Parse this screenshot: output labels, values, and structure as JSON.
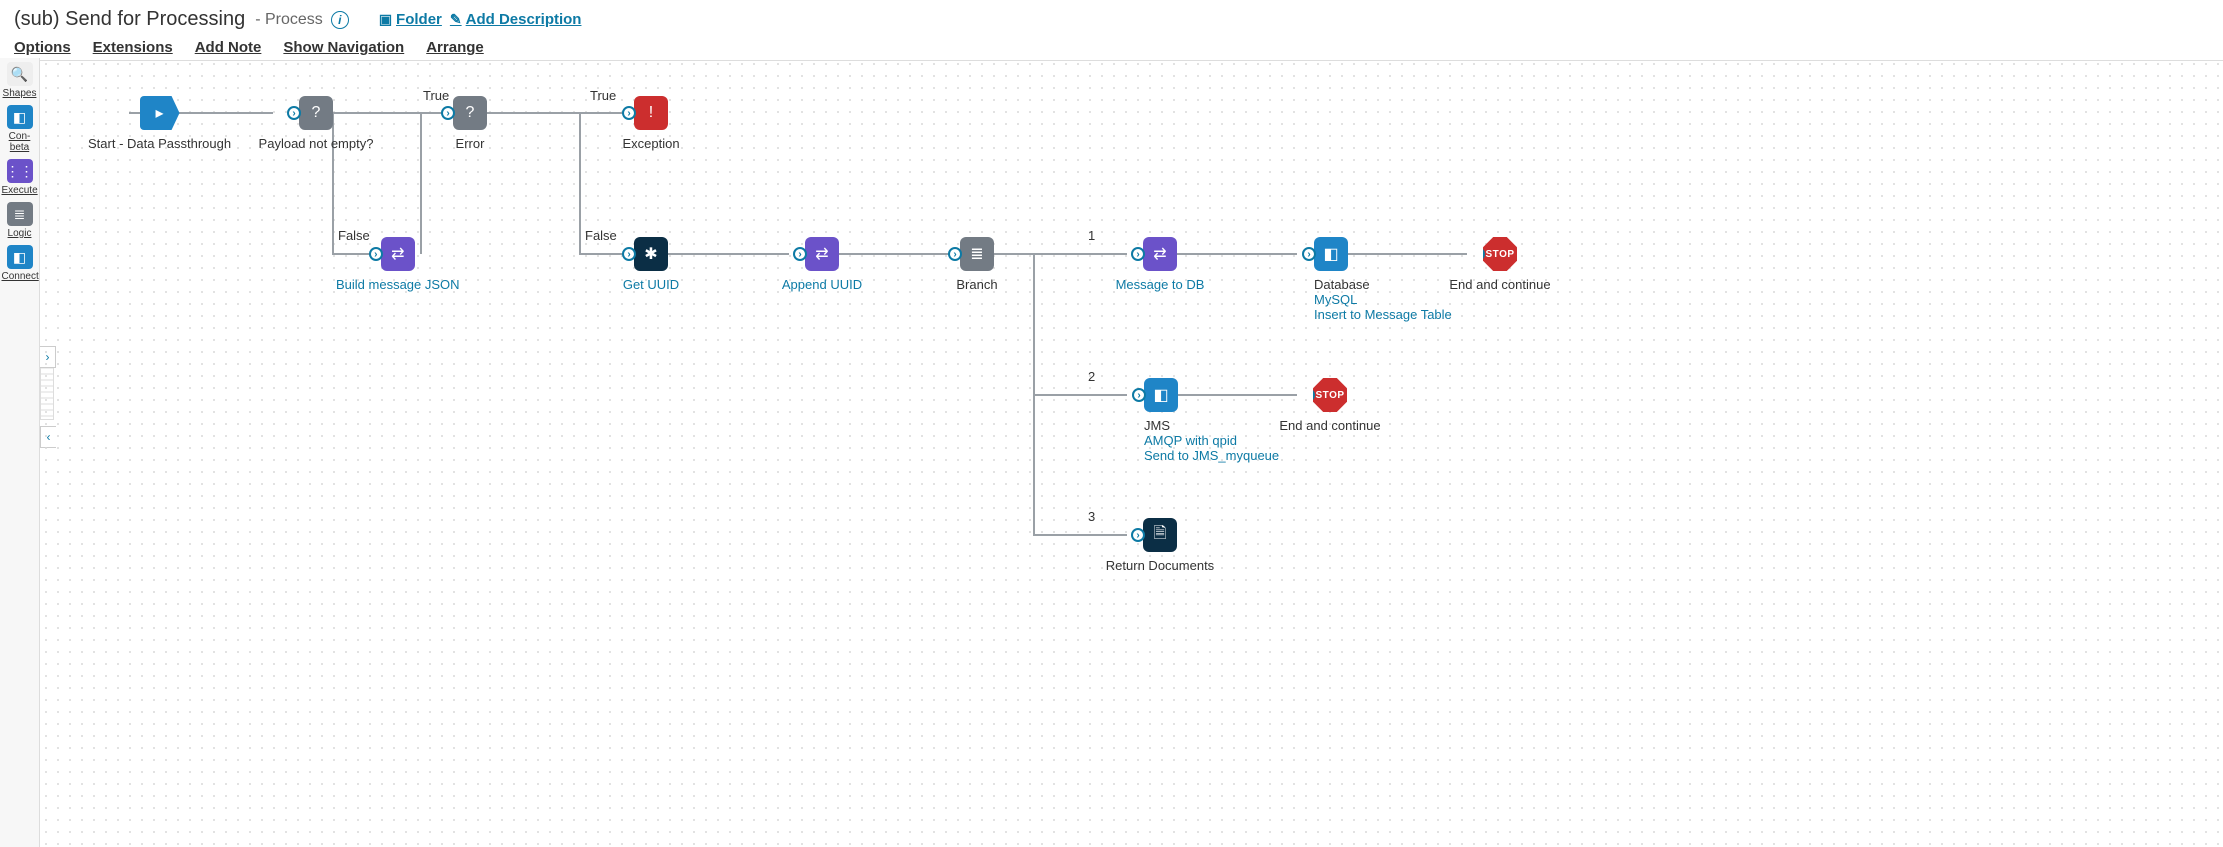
{
  "header": {
    "title": "(sub) Send for Processing",
    "subtype": "- Process",
    "folder": "Folder",
    "add_desc": "Add Description"
  },
  "menu": {
    "options": "Options",
    "extensions": "Extensions",
    "add_note": "Add Note",
    "show_nav": "Show Navigation",
    "arrange": "Arrange"
  },
  "rail": {
    "shapes": "Shapes",
    "con_beta": "Con-beta",
    "execute": "Execute",
    "logic": "Logic",
    "connect": "Connect"
  },
  "labels": {
    "true": "True",
    "false": "False"
  },
  "branch_nums": {
    "b1": "1",
    "b2": "2",
    "b3": "3"
  },
  "nodes": {
    "start": "Start - Data Passthrough",
    "decision1": "Payload not empty?",
    "decision2": "Error",
    "exception": "Exception",
    "build_json": "Build message JSON",
    "get_uuid": "Get UUID",
    "append_uuid": "Append UUID",
    "branch": "Branch",
    "msg_db": "Message to DB",
    "db_line1": "Database",
    "db_line2": "MySQL",
    "db_line3": "Insert to Message Table",
    "end1": "End and continue",
    "jms": "JMS",
    "jms_line2": "AMQP with qpid",
    "jms_line3": "Send to JMS_myqueue",
    "end2": "End and continue",
    "return": "Return Documents",
    "stop": "STOP"
  }
}
